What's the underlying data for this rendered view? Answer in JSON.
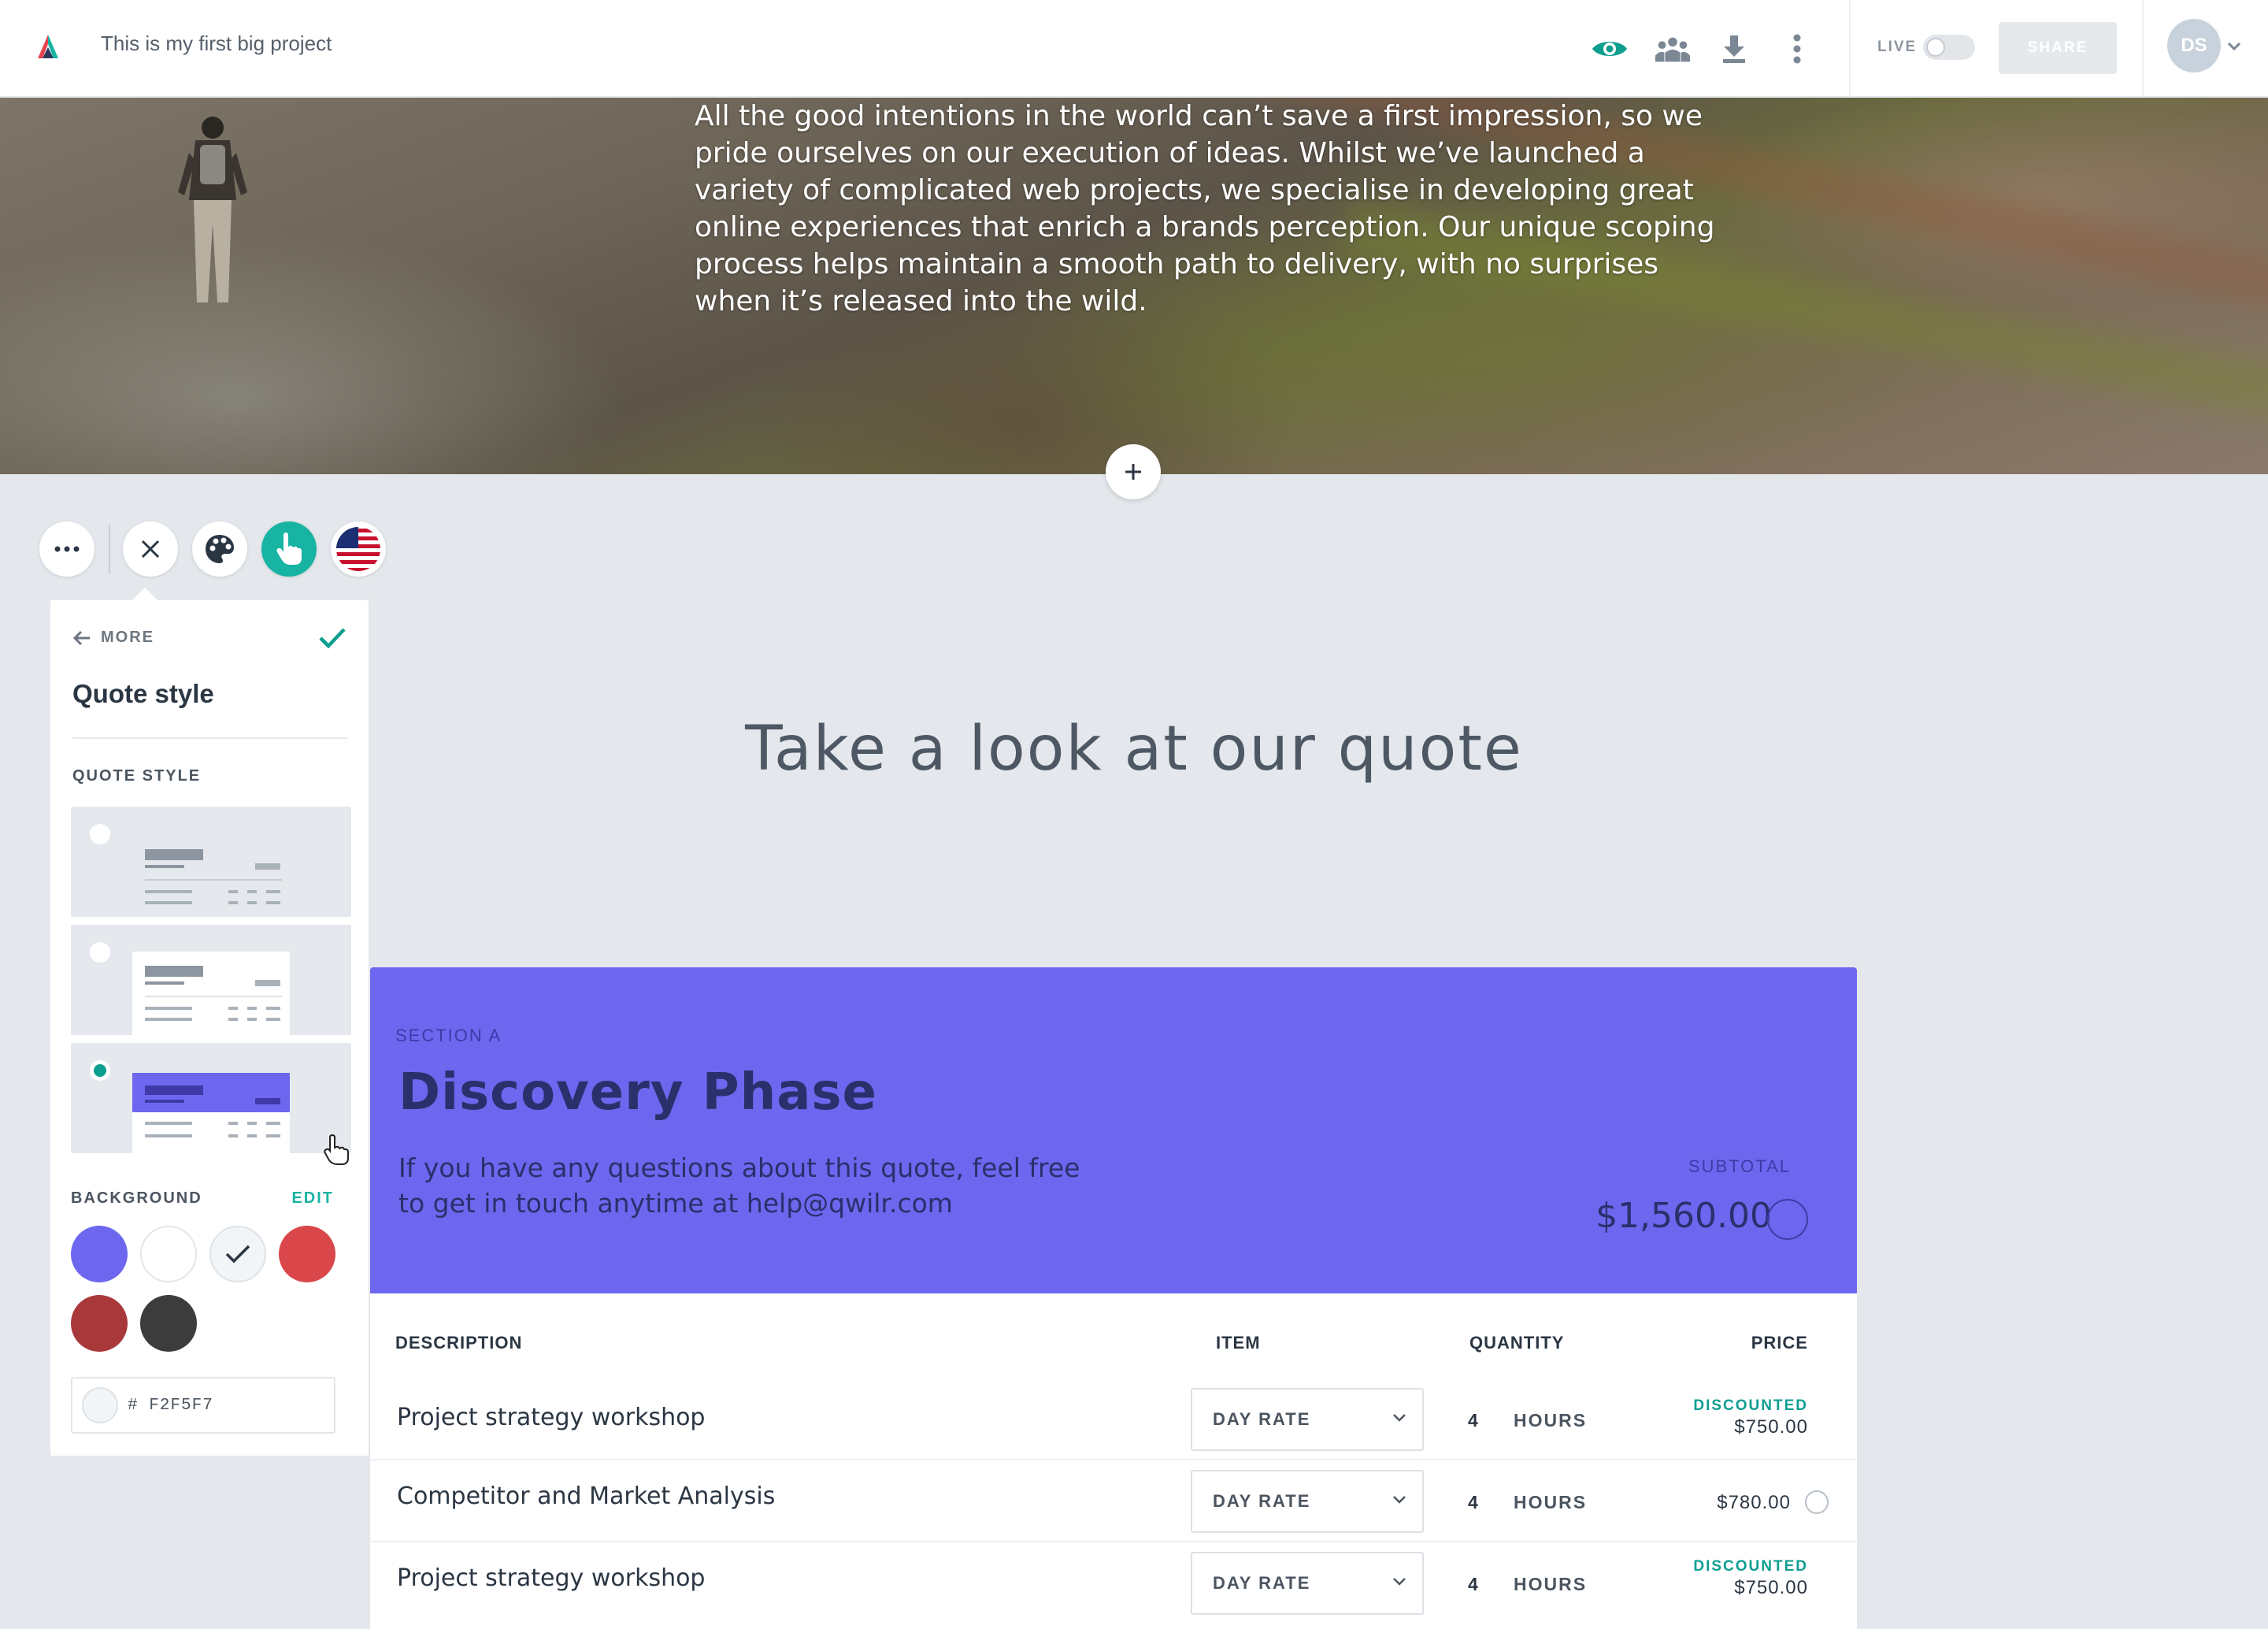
{
  "header": {
    "doc_title": "This is my first big project",
    "live_label": "LIVE",
    "share_label": "SHARE",
    "avatar_initials": "DS"
  },
  "hero": {
    "text": "All the good intentions in the world can’t save a first impression, so we pride ourselves on our execution of ideas. Whilst we’ve launched a variety of complicated web projects, we specialise in developing great online experiences that enrich a brands perception. Our unique scoping process helps maintain a smooth path to delivery, with no surprises when it’s released into the wild."
  },
  "panel": {
    "back_label": "MORE",
    "title": "Quote style",
    "quote_style_label": "QUOTE STYLE",
    "background_label": "BACKGROUND",
    "edit_label": "EDIT",
    "selected_style": 3,
    "swatches": [
      "#6c67ee",
      "#ffffff",
      "#f2f5f7",
      "#d9474b",
      "#a9383a",
      "#3c3c3c"
    ],
    "selected_swatch": "#f2f5f7",
    "hex_value": "# F2F5F7"
  },
  "page": {
    "heading": "Take a look at our quote"
  },
  "quote": {
    "section_kicker": "SECTION A",
    "section_title": "Discovery Phase",
    "section_desc": "If you have any questions about this quote, feel free to get in touch anytime at help@qwilr.com",
    "subtotal_label": "SUBTOTAL",
    "subtotal_value": "$1,560.00",
    "accent_color": "#6c67ee",
    "columns": {
      "description": "DESCRIPTION",
      "item": "ITEM",
      "quantity": "QUANTITY",
      "price": "PRICE"
    },
    "rows": [
      {
        "description": "Project strategy workshop",
        "item": "DAY RATE",
        "qty": "4",
        "unit": "HOURS",
        "tag": "DISCOUNTED",
        "price": "$750.00"
      },
      {
        "description": "Competitor and Market Analysis",
        "item": "DAY RATE",
        "qty": "4",
        "unit": "HOURS",
        "tag": "",
        "price": "$780.00"
      },
      {
        "description": "Project strategy workshop",
        "item": "DAY RATE",
        "qty": "4",
        "unit": "HOURS",
        "tag": "DISCOUNTED",
        "price": "$750.00"
      }
    ]
  },
  "icons": {
    "logo": "qwilr-logo-icon",
    "preview": "eye-icon",
    "collaborators": "people-icon",
    "download": "download-icon",
    "more": "vertical-dots-icon",
    "add": "plus-icon",
    "block_more": "horizontal-dots-icon",
    "close": "close-icon",
    "palette": "palette-icon",
    "interactive": "hand-pointer-icon",
    "language": "us-flag-icon"
  }
}
